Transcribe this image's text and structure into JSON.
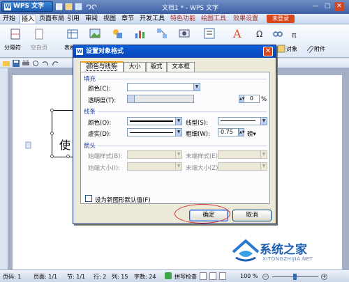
{
  "app": {
    "button_label": "WPS 文字",
    "doc_title": "文档1 * - WPS 文字"
  },
  "menu": {
    "tabs": [
      "开始",
      "插入",
      "页面布局",
      "引用",
      "审阅",
      "视图",
      "章节",
      "开发工具",
      "特色功能",
      "绘图工具",
      "效果设置"
    ],
    "active": "插入",
    "login": "未登录"
  },
  "ribbon": {
    "items": [
      "分隔符",
      "空白页",
      "表格",
      "对象",
      "附件"
    ]
  },
  "dialog": {
    "title": "设置对象格式",
    "tabs": [
      "颜色与线条",
      "大小",
      "版式",
      "文本框"
    ],
    "fill_section": "填充",
    "fill_color_label": "颜色(C):",
    "transparency_label": "透明度(T):",
    "transparency_value": "0",
    "transparency_unit": "%",
    "line_section": "线条",
    "line_color_label": "颜色(O):",
    "line_style_label": "线型(S):",
    "dash_label": "虚实(D):",
    "weight_label": "粗细(W):",
    "weight_value": "0.75",
    "weight_unit": "磅▾",
    "arrow_section": "箭头",
    "begin_style_label": "始端样式(B):",
    "end_style_label": "末端样式(E):",
    "begin_size_label": "始端大小(I):",
    "end_size_label": "末端大小(Z):",
    "default_checkbox_label": "设为新图形默认值(F)",
    "ok_label": "确定",
    "cancel_label": "取消"
  },
  "document": {
    "textbox_text": "使"
  },
  "statusbar": {
    "page_no": "页码: 1",
    "page": "页面: 1/1",
    "section": "节: 1/1",
    "row": "行: 2",
    "col": "列: 15",
    "words": "字数: 24",
    "spellcheck": "拼写检查",
    "zoom": "100 %"
  },
  "watermark": {
    "name": "系统之家",
    "url": "XITONGZHIJIA.NET"
  }
}
